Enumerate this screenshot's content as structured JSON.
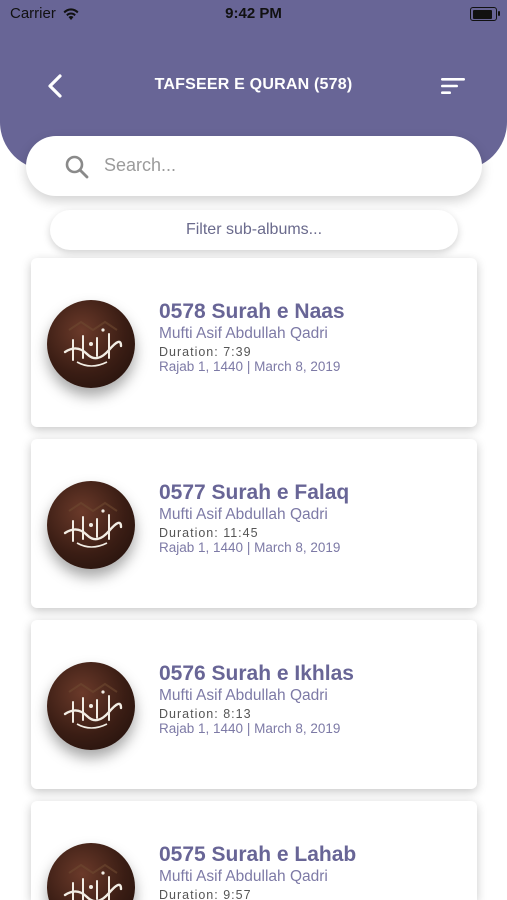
{
  "status_bar": {
    "carrier": "Carrier",
    "time": "9:42 PM",
    "battery_level": 0.95
  },
  "nav": {
    "title": "TAFSEER E QURAN (578)",
    "back_icon": "chevron-left-icon",
    "sort_icon": "sort-icon"
  },
  "search": {
    "placeholder": "Search...",
    "icon": "search-icon"
  },
  "filter": {
    "label": "Filter sub-albums..."
  },
  "colors": {
    "header": "#686596",
    "title": "#686596",
    "subtext": "#7d7aa6"
  },
  "items": [
    {
      "title": "0578 Surah e Naas",
      "speaker": "Mufti Asif Abdullah Qadri",
      "duration": "Duration: 7:39",
      "date": "Rajab 1, 1440 | March 8, 2019"
    },
    {
      "title": "0577 Surah e Falaq",
      "speaker": "Mufti Asif Abdullah Qadri",
      "duration": "Duration: 11:45",
      "date": "Rajab 1, 1440 | March 8, 2019"
    },
    {
      "title": "0576 Surah e Ikhlas",
      "speaker": "Mufti Asif Abdullah Qadri",
      "duration": "Duration: 8:13",
      "date": "Rajab 1, 1440 | March 8, 2019"
    },
    {
      "title": "0575 Surah e Lahab",
      "speaker": "Mufti Asif Abdullah Qadri",
      "duration": "Duration: 9:57",
      "date": ""
    }
  ]
}
